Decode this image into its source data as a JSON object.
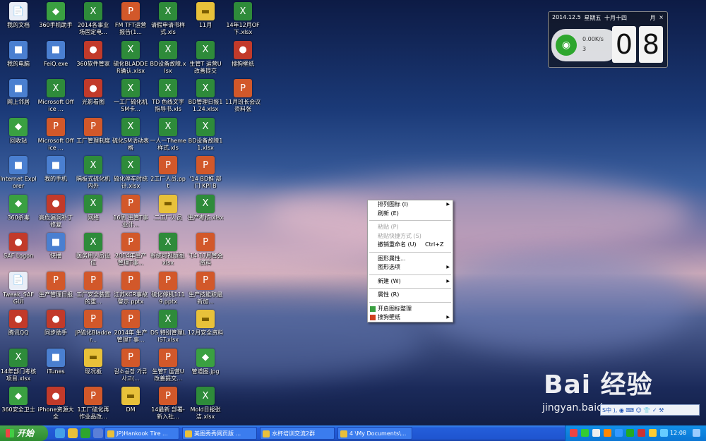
{
  "desktop_icons": [
    {
      "label": "我的文档",
      "type": "doc",
      "col": 0,
      "row": 0
    },
    {
      "label": "我的电脑",
      "type": "sys",
      "col": 0,
      "row": 1
    },
    {
      "label": "网上邻居",
      "type": "sys",
      "col": 0,
      "row": 2
    },
    {
      "label": "回收站",
      "type": "grn",
      "col": 0,
      "row": 3
    },
    {
      "label": "Internet Explorer",
      "type": "sys",
      "col": 0,
      "row": 4
    },
    {
      "label": "360杀毒",
      "type": "grn",
      "col": 0,
      "row": 5
    },
    {
      "label": "SAF Logon",
      "type": "app",
      "col": 0,
      "row": 6
    },
    {
      "label": "Tweak_SAF GUI",
      "type": "doc",
      "col": 0,
      "row": 7
    },
    {
      "label": "腾讯QQ",
      "type": "app",
      "col": 0,
      "row": 8
    },
    {
      "label": "14年部门考核项目.xlsx",
      "type": "xls",
      "col": 0,
      "row": 9
    },
    {
      "label": "360安全卫士",
      "type": "grn",
      "col": 0,
      "row": 10
    },
    {
      "label": "360手机助手",
      "type": "grn",
      "col": 1,
      "row": 0
    },
    {
      "label": "FeiQ.exe",
      "type": "sys",
      "col": 1,
      "row": 1
    },
    {
      "label": "Microsoft Office ...",
      "type": "xls",
      "col": 1,
      "row": 2
    },
    {
      "label": "Microsoft Office ...",
      "type": "ppt",
      "col": 1,
      "row": 3
    },
    {
      "label": "我的手机",
      "type": "sys",
      "col": 1,
      "row": 4
    },
    {
      "label": "高危漏洞补丁修复",
      "type": "app",
      "col": 1,
      "row": 5
    },
    {
      "label": "快播",
      "type": "sys",
      "col": 1,
      "row": 6
    },
    {
      "label": "生产管理日报",
      "type": "ppt",
      "col": 1,
      "row": 7
    },
    {
      "label": "同步助手",
      "type": "app",
      "col": 1,
      "row": 8
    },
    {
      "label": "iTunes",
      "type": "sys",
      "col": 1,
      "row": 9
    },
    {
      "label": "iPhone资源大全",
      "type": "app",
      "col": 1,
      "row": 10
    },
    {
      "label": "2014各事业场固定电...",
      "type": "xls",
      "col": 2,
      "row": 0
    },
    {
      "label": "360软件管家",
      "type": "app",
      "col": 2,
      "row": 1
    },
    {
      "label": "光影看图",
      "type": "app",
      "col": 2,
      "row": 2
    },
    {
      "label": "工厂管理制度",
      "type": "ppt",
      "col": 2,
      "row": 3
    },
    {
      "label": "隔板式硫化机内外",
      "type": "xls",
      "col": 2,
      "row": 4
    },
    {
      "label": "网络",
      "type": "xls",
      "col": 2,
      "row": 5
    },
    {
      "label": "医务用人员设位",
      "type": "xls",
      "col": 2,
      "row": 6
    },
    {
      "label": "工厂安全装置的重...",
      "type": "ppt",
      "col": 2,
      "row": 7
    },
    {
      "label": "JP硫化Bladder...",
      "type": "ppt",
      "col": 2,
      "row": 8
    },
    {
      "label": "现况板",
      "type": "fold",
      "col": 2,
      "row": 9
    },
    {
      "label": "1工厂硫化再作业品改...",
      "type": "ppt",
      "col": 2,
      "row": 10
    },
    {
      "label": "FM TFT运营报告(1...",
      "type": "ppt",
      "col": 3,
      "row": 0
    },
    {
      "label": "硫化BLADDER确认.xlsx",
      "type": "xls",
      "col": 3,
      "row": 1
    },
    {
      "label": "一工厂硫化机SM卡...",
      "type": "xls",
      "col": 3,
      "row": 2
    },
    {
      "label": "硫化SM活动表格",
      "type": "xls",
      "col": 3,
      "row": 3
    },
    {
      "label": "硫化停车时统计.xlsx",
      "type": "xls",
      "col": 3,
      "row": 4
    },
    {
      "label": "16周 生管T事业计...",
      "type": "ppt",
      "col": 3,
      "row": 5
    },
    {
      "label": "2014年生产管理T事...",
      "type": "ppt",
      "col": 3,
      "row": 6
    },
    {
      "label": "江苏KCR事故警示.pptx",
      "type": "ppt",
      "col": 3,
      "row": 7
    },
    {
      "label": "2014年 生产管理T 事...",
      "type": "ppt",
      "col": 3,
      "row": 8
    },
    {
      "label": "갈소공장 가류 사고(...",
      "type": "ppt",
      "col": 3,
      "row": 9
    },
    {
      "label": "DM",
      "type": "fold",
      "col": 3,
      "row": 10
    },
    {
      "label": "请假申请书样式.xls",
      "type": "xls",
      "col": 4,
      "row": 0
    },
    {
      "label": "BD设备故障.xlsx",
      "type": "xls",
      "col": 4,
      "row": 1
    },
    {
      "label": "TD 色线文字指导书.xls",
      "type": "xls",
      "col": 4,
      "row": 2
    },
    {
      "label": "一人一Theme样式.xls",
      "type": "xls",
      "col": 4,
      "row": 3
    },
    {
      "label": "2工厂人员.ppt",
      "type": "ppt",
      "col": 4,
      "row": 4
    },
    {
      "label": "二工厂人员",
      "type": "fold",
      "col": 4,
      "row": 5
    },
    {
      "label": "系统可视版图.xlsx",
      "type": "xls",
      "col": 4,
      "row": 6
    },
    {
      "label": "硫化停机1119.pptx",
      "type": "ppt",
      "col": 4,
      "row": 7
    },
    {
      "label": "DS 特别管理LIST.xlsx",
      "type": "xls",
      "col": 4,
      "row": 8
    },
    {
      "label": "生管T 运营U改善提交...",
      "type": "ppt",
      "col": 4,
      "row": 9
    },
    {
      "label": "14最新 部署-新入社...",
      "type": "ppt",
      "col": 4,
      "row": 10
    },
    {
      "label": "11月",
      "type": "fold",
      "col": 5,
      "row": 0
    },
    {
      "label": "生管T 运营U改善提交",
      "type": "xls",
      "col": 5,
      "row": 1
    },
    {
      "label": "BD管理日报11.24.xlsx",
      "type": "xls",
      "col": 5,
      "row": 2
    },
    {
      "label": "BD设备故障11.xlsx",
      "type": "xls",
      "col": 5,
      "row": 3
    },
    {
      "label": "'14 BD推 部门 KPI B",
      "type": "ppt",
      "col": 5,
      "row": 4
    },
    {
      "label": "生产考核.xlsx",
      "type": "xls",
      "col": 5,
      "row": 5
    },
    {
      "label": "'14 11月管会资料",
      "type": "ppt",
      "col": 5,
      "row": 6
    },
    {
      "label": "生产技能职最新加...",
      "type": "ppt",
      "col": 5,
      "row": 7
    },
    {
      "label": "12月安全资料",
      "type": "fold",
      "col": 5,
      "row": 8
    },
    {
      "label": "管道图.jpg",
      "type": "grn",
      "col": 5,
      "row": 9
    },
    {
      "label": "Mold日报张洁.xlsx",
      "type": "xls",
      "col": 5,
      "row": 10
    },
    {
      "label": "14年12月OF下.xlsx",
      "type": "xls",
      "col": 6,
      "row": 0
    },
    {
      "label": "搜狗壁纸",
      "type": "app",
      "col": 6,
      "row": 1
    },
    {
      "label": "11月班长会议资料张",
      "type": "ppt",
      "col": 6,
      "row": 2
    }
  ],
  "clock": {
    "date": "2014.12.5",
    "weekday": "星期五",
    "lunar": "十月十四",
    "settings_label": "月",
    "close_label": "×",
    "hour_digit": "0",
    "minute_digit": "8",
    "net_speed": "0.00K/s",
    "net_count": "3"
  },
  "context_menu": {
    "items": [
      {
        "label": "排列图标 (I)",
        "enabled": true,
        "arrow": true,
        "shortcut": "",
        "icon": ""
      },
      {
        "label": "刷新 (E)",
        "enabled": true,
        "arrow": false,
        "shortcut": "",
        "icon": ""
      },
      {
        "sep": true
      },
      {
        "label": "粘贴 (P)",
        "enabled": false,
        "arrow": false,
        "shortcut": "",
        "icon": ""
      },
      {
        "label": "粘贴快捷方式 (S)",
        "enabled": false,
        "arrow": false,
        "shortcut": "",
        "icon": ""
      },
      {
        "label": "撤销重命名 (U)",
        "enabled": true,
        "arrow": false,
        "shortcut": "Ctrl+Z",
        "icon": ""
      },
      {
        "sep": true
      },
      {
        "label": "图形属性...",
        "enabled": true,
        "arrow": false,
        "shortcut": "",
        "icon": ""
      },
      {
        "label": "图形选项",
        "enabled": true,
        "arrow": true,
        "shortcut": "",
        "icon": ""
      },
      {
        "sep": true
      },
      {
        "label": "新建 (W)",
        "enabled": true,
        "arrow": true,
        "shortcut": "",
        "icon": ""
      },
      {
        "sep": true
      },
      {
        "label": "属性 (R)",
        "enabled": true,
        "arrow": false,
        "shortcut": "",
        "icon": ""
      },
      {
        "sep": true
      },
      {
        "label": "开启图标整理",
        "enabled": true,
        "arrow": false,
        "shortcut": "",
        "icon": "grid"
      },
      {
        "label": "搜狗壁纸",
        "enabled": true,
        "arrow": true,
        "shortcut": "",
        "icon": "sogou"
      }
    ]
  },
  "watermark": {
    "logo": "Bai 经验",
    "url": "jingyan.baidu.com"
  },
  "ime": {
    "text": "S中 ), ◉ ⌨ ☺ 👕 ✓ ⚒"
  },
  "taskbar": {
    "start_label": "开始",
    "tasks": [
      "JP)Hankook Tire ...",
      "美图秀秀网页版 ...",
      "水杯培训交流2群",
      "4 \\My Documents\\..."
    ],
    "time": "12:08"
  },
  "colors": {
    "taskbar": "#245edb",
    "start": "#2d8b2f",
    "tray": "#0b76d4"
  }
}
